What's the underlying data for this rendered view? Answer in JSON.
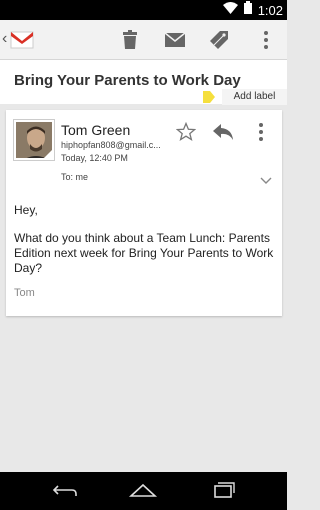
{
  "status_bar": {
    "time": "1:02"
  },
  "toolbar": {
    "icons": [
      "gmail-logo-icon",
      "trash-icon",
      "mail-icon",
      "label-icon",
      "overflow-menu-icon"
    ]
  },
  "message": {
    "subject": "Bring Your Parents to Work Day",
    "add_label": "Add label",
    "sender_name": "Tom Green",
    "sender_email": "hiphopfan808@gmail.c...",
    "time": "Today, 12:40 PM",
    "recipients": "To: me",
    "greeting": "Hey,",
    "body": "What do you think about a Team Lunch: Parents Edition next week for Bring Your Parents to Work Day?",
    "signature": "Tom"
  },
  "colors": {
    "gmail_red": "#d93025",
    "label_yellow": "#f5df3d",
    "icon_gray": "#666666"
  }
}
